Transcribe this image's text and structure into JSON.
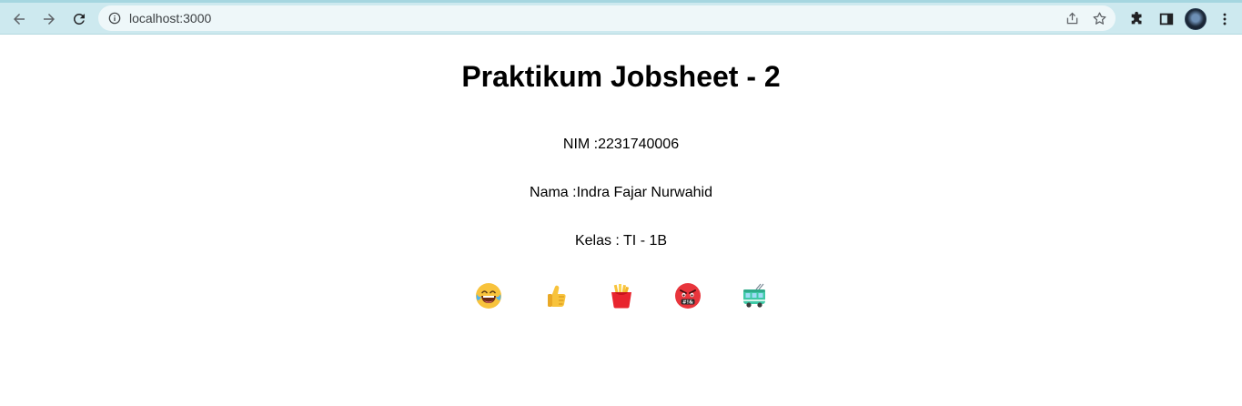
{
  "browser": {
    "url": "localhost:3000",
    "accent": "#cde9ef"
  },
  "page": {
    "title": "Praktikum Jobsheet - 2",
    "nim": "NIM :2231740006",
    "nama": "Nama :Indra Fajar Nurwahid",
    "kelas": "Kelas : TI - 1B"
  },
  "emojis": [
    {
      "name": "laughing-face-icon"
    },
    {
      "name": "thumbs-up-icon"
    },
    {
      "name": "french-fries-icon"
    },
    {
      "name": "cursing-face-icon"
    },
    {
      "name": "trolleybus-icon"
    }
  ]
}
